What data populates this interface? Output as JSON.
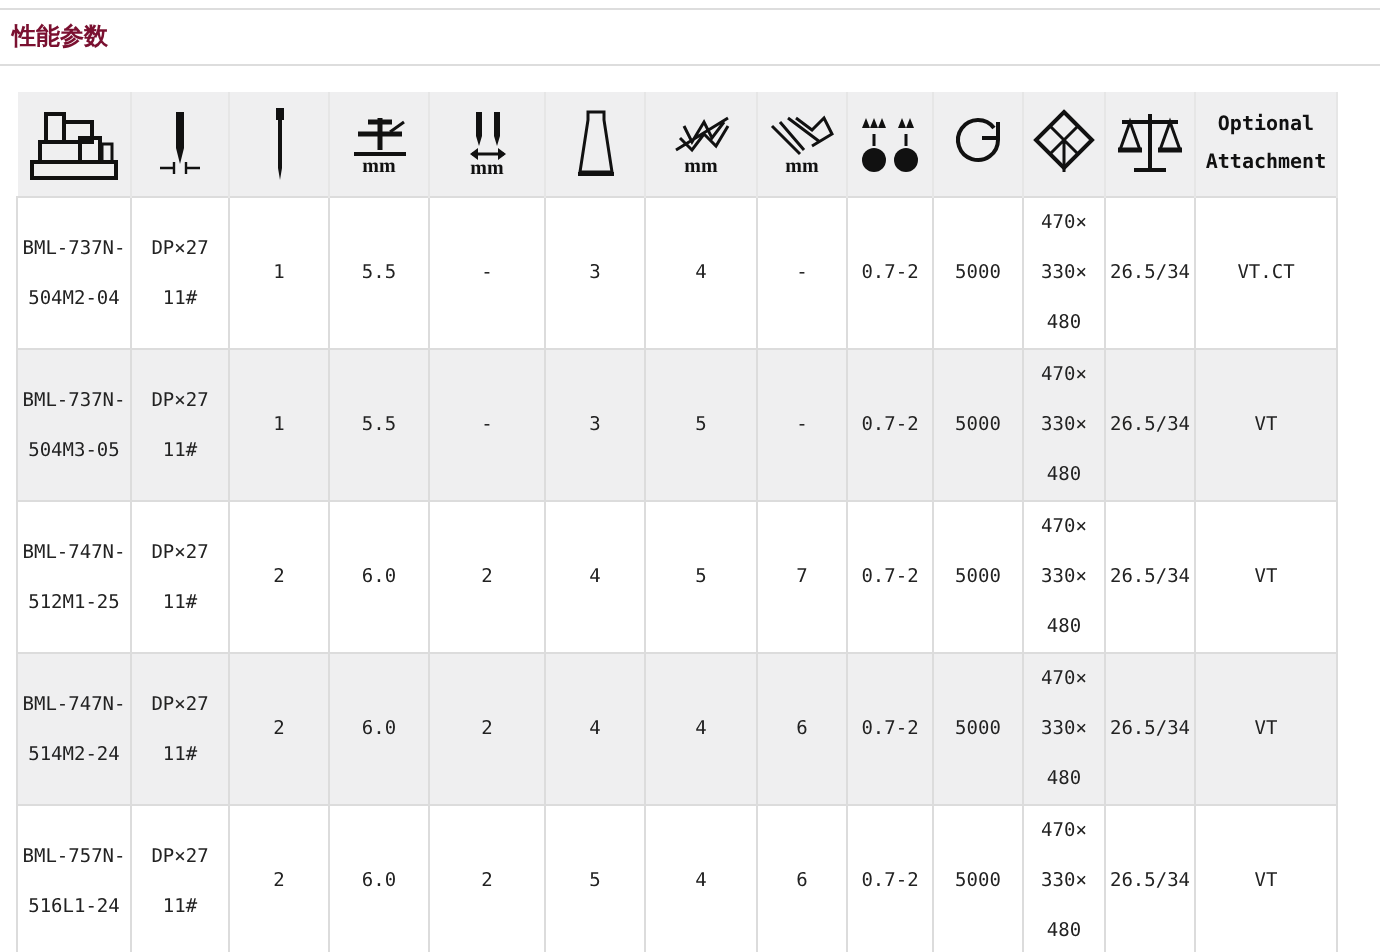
{
  "section_title": "性能参数",
  "columns": [
    {
      "kind": "icon"
    },
    {
      "kind": "icon"
    },
    {
      "kind": "icon"
    },
    {
      "kind": "icon",
      "unit": "mm"
    },
    {
      "kind": "icon",
      "unit": "mm"
    },
    {
      "kind": "icon"
    },
    {
      "kind": "icon",
      "unit": "mm"
    },
    {
      "kind": "icon",
      "unit": "mm"
    },
    {
      "kind": "icon"
    },
    {
      "kind": "icon"
    },
    {
      "kind": "icon"
    },
    {
      "kind": "icon"
    },
    {
      "kind": "text",
      "label": "Optional Attachment"
    }
  ],
  "rows": [
    {
      "cells": [
        "BML-737N-504M2-04",
        "DP×27 11#",
        "1",
        "5.5",
        "-",
        "3",
        "4",
        "-",
        "0.7-2",
        "5000",
        "470×330×480",
        "26.5/34",
        "VT.CT"
      ]
    },
    {
      "cells": [
        "BML-737N-504M3-05",
        "DP×27 11#",
        "1",
        "5.5",
        "-",
        "3",
        "5",
        "-",
        "0.7-2",
        "5000",
        "470×330×480",
        "26.5/34",
        "VT"
      ]
    },
    {
      "cells": [
        "BML-747N-512M1-25",
        "DP×27 11#",
        "2",
        "6.0",
        "2",
        "4",
        "5",
        "7",
        "0.7-2",
        "5000",
        "470×330×480",
        "26.5/34",
        "VT"
      ]
    },
    {
      "cells": [
        "BML-747N-514M2-24",
        "DP×27 11#",
        "2",
        "6.0",
        "2",
        "4",
        "4",
        "6",
        "0.7-2",
        "5000",
        "470×330×480",
        "26.5/34",
        "VT"
      ]
    },
    {
      "cells": [
        "BML-757N-516L1-24",
        "DP×27 11#",
        "2",
        "6.0",
        "2",
        "5",
        "4",
        "6",
        "0.7-2",
        "5000",
        "470×330×480",
        "26.5/34",
        "VT"
      ]
    }
  ]
}
